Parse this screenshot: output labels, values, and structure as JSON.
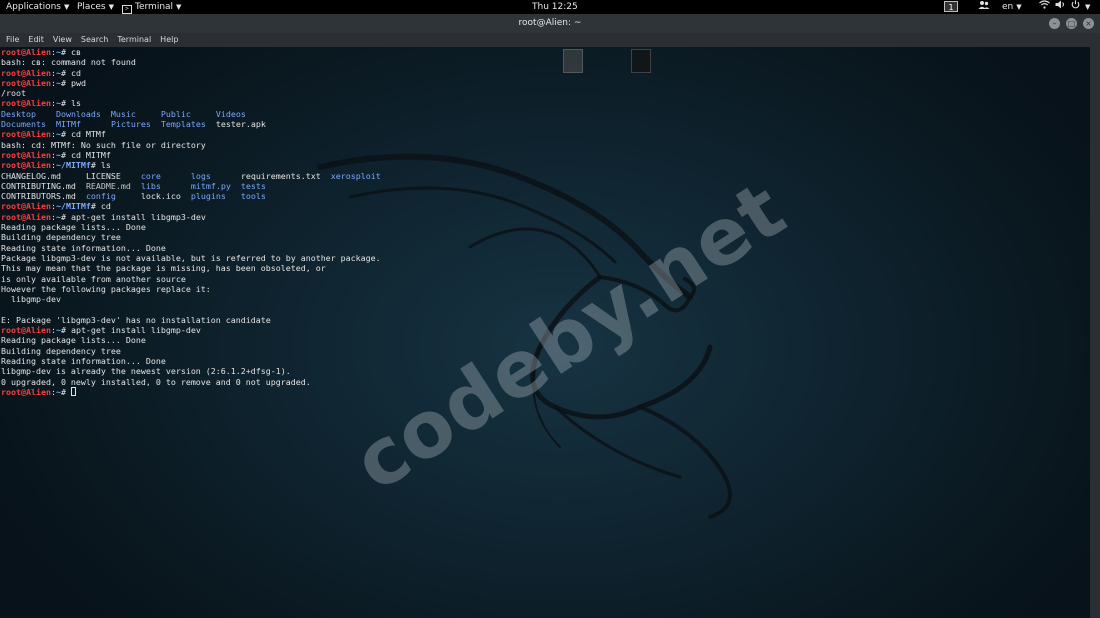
{
  "topbar": {
    "applications": "Applications",
    "places": "Places",
    "terminal": "Terminal",
    "clock": "Thu 12:25",
    "workspace": "1",
    "lang": "en"
  },
  "window": {
    "title": "root@Alien: ~",
    "menu": [
      "File",
      "Edit",
      "View",
      "Search",
      "Terminal",
      "Help"
    ]
  },
  "watermark": "codeby.net",
  "terminal": {
    "user": "root@Alien",
    "lines": [
      {
        "t": "cmd",
        "path": "~",
        "sym": "#",
        "cmd": " cв"
      },
      {
        "t": "out",
        "text": "bash: cв: command not found"
      },
      {
        "t": "cmd",
        "path": "~",
        "sym": "#",
        "cmd": " cd"
      },
      {
        "t": "cmd",
        "path": "~",
        "sym": "#",
        "cmd": " pwd"
      },
      {
        "t": "out",
        "text": "/root"
      },
      {
        "t": "cmd",
        "path": "~",
        "sym": "#",
        "cmd": " ls"
      },
      {
        "t": "ls",
        "parts": [
          [
            "Desktop",
            "d"
          ],
          [
            "    ",
            ""
          ],
          [
            "Downloads",
            "d"
          ],
          [
            "  ",
            ""
          ],
          [
            "Music",
            "d"
          ],
          [
            "     ",
            ""
          ],
          [
            "Public",
            "d"
          ],
          [
            "     ",
            ""
          ],
          [
            "Videos",
            "d"
          ]
        ]
      },
      {
        "t": "ls",
        "parts": [
          [
            "Documents",
            "d"
          ],
          [
            "  ",
            ""
          ],
          [
            "MITMf",
            "d"
          ],
          [
            "      ",
            ""
          ],
          [
            "Pictures",
            "d"
          ],
          [
            "  ",
            ""
          ],
          [
            "Templates",
            "d"
          ],
          [
            "  ",
            ""
          ],
          [
            "tester.apk",
            ""
          ]
        ]
      },
      {
        "t": "cmd",
        "path": "~",
        "sym": "#",
        "cmd": " cd MTMf"
      },
      {
        "t": "out",
        "text": "bash: cd: MTMf: No such file or directory"
      },
      {
        "t": "cmd",
        "path": "~",
        "sym": "#",
        "cmd": " cd MITMf"
      },
      {
        "t": "cmd",
        "path": "~/MITMf",
        "sym": "#",
        "cmd": " ls"
      },
      {
        "t": "ls",
        "parts": [
          [
            "CHANGELOG.md",
            ""
          ],
          [
            "     ",
            ""
          ],
          [
            "LICENSE",
            ""
          ],
          [
            "    ",
            ""
          ],
          [
            "core",
            "d"
          ],
          [
            "      ",
            ""
          ],
          [
            "logs",
            "d"
          ],
          [
            "      ",
            ""
          ],
          [
            "requirements.txt",
            ""
          ],
          [
            "  ",
            ""
          ],
          [
            "xerosploit",
            "d"
          ]
        ]
      },
      {
        "t": "ls",
        "parts": [
          [
            "CONTRIBUTING.md",
            ""
          ],
          [
            "  ",
            ""
          ],
          [
            "README.md",
            "h"
          ],
          [
            "  ",
            ""
          ],
          [
            "libs",
            "d"
          ],
          [
            "      ",
            ""
          ],
          [
            "mitmf.py",
            "x"
          ],
          [
            "  ",
            ""
          ],
          [
            "tests",
            "d"
          ]
        ]
      },
      {
        "t": "ls",
        "parts": [
          [
            "CONTRIBUTORS.md",
            ""
          ],
          [
            "  ",
            ""
          ],
          [
            "config",
            "d"
          ],
          [
            "     ",
            ""
          ],
          [
            "lock.ico",
            ""
          ],
          [
            "  ",
            ""
          ],
          [
            "plugins",
            "d"
          ],
          [
            "   ",
            ""
          ],
          [
            "tools",
            "d"
          ]
        ]
      },
      {
        "t": "cmd",
        "path": "~/MITMf",
        "sym": "#",
        "cmd": " cd"
      },
      {
        "t": "cmd",
        "path": "~",
        "sym": "#",
        "cmd": " apt-get install libgmp3-dev"
      },
      {
        "t": "out",
        "text": "Reading package lists... Done"
      },
      {
        "t": "out",
        "text": "Building dependency tree"
      },
      {
        "t": "out",
        "text": "Reading state information... Done"
      },
      {
        "t": "out",
        "text": "Package libgmp3-dev is not available, but is referred to by another package."
      },
      {
        "t": "out",
        "text": "This may mean that the package is missing, has been obsoleted, or"
      },
      {
        "t": "out",
        "text": "is only available from another source"
      },
      {
        "t": "out",
        "text": "However the following packages replace it:"
      },
      {
        "t": "out",
        "text": "  libgmp-dev"
      },
      {
        "t": "out",
        "text": ""
      },
      {
        "t": "out",
        "text": "E: Package 'libgmp3-dev' has no installation candidate"
      },
      {
        "t": "cmd",
        "path": "~",
        "sym": "#",
        "cmd": " apt-get install libgmp-dev"
      },
      {
        "t": "out",
        "text": "Reading package lists... Done"
      },
      {
        "t": "out",
        "text": "Building dependency tree"
      },
      {
        "t": "out",
        "text": "Reading state information... Done"
      },
      {
        "t": "out",
        "text": "libgmp-dev is already the newest version (2:6.1.2+dfsg-1)."
      },
      {
        "t": "out",
        "text": "0 upgraded, 0 newly installed, 0 to remove and 0 not upgraded."
      },
      {
        "t": "cmd",
        "path": "~",
        "sym": "#",
        "cmd": " ",
        "cursor": true
      }
    ]
  },
  "colors": {
    "prompt_user": "#ff3b3b",
    "prompt_path": "#7aa9ff",
    "directory": "#7aa9ff",
    "text": "#e4e4e4"
  }
}
